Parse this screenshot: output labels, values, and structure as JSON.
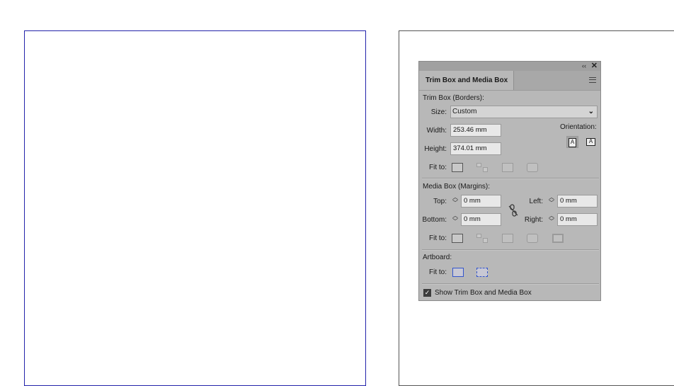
{
  "panel": {
    "tab_label": "Trim Box and Media Box",
    "collapse_glyph": "‹‹",
    "close_glyph": "✕",
    "trim": {
      "section_label": "Trim Box (Borders):",
      "size_label": "Size:",
      "size_value": "Custom",
      "width_label": "Width:",
      "width_value": "253.46 mm",
      "height_label": "Height:",
      "height_value": "374.01 mm",
      "orientation_label": "Orientation:",
      "orientation_portrait_glyph": "A",
      "orientation_landscape_glyph": "A",
      "fit_label": "Fit to:"
    },
    "media": {
      "section_label": "Media Box (Margins):",
      "top_label": "Top:",
      "top_value": "0 mm",
      "bottom_label": "Bottom:",
      "bottom_value": "0 mm",
      "left_label": "Left:",
      "left_value": "0 mm",
      "right_label": "Right:",
      "right_value": "0 mm",
      "fit_label": "Fit to:"
    },
    "artboard": {
      "section_label": "Artboard:",
      "fit_label": "Fit to:"
    },
    "show_checkbox_label": "Show Trim Box and Media Box",
    "show_checked": true
  },
  "colors": {
    "panel_bg": "#b8b8b8",
    "artboard_border": "#2222aa",
    "accent_blue": "#3355cc"
  },
  "icons": {
    "collapse": "double-chevron-left-icon",
    "close": "close-icon",
    "menu": "hamburger-menu-icon",
    "link": "unlink-chain-icon",
    "stepper": "up-down-stepper-icon"
  }
}
